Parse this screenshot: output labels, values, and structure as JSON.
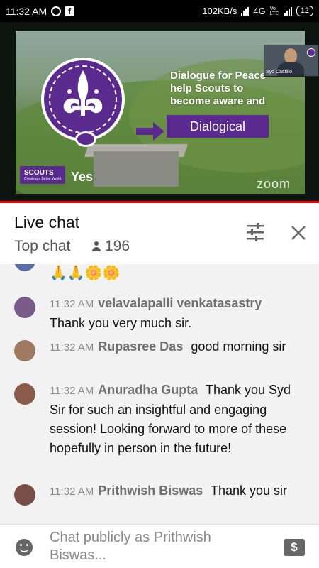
{
  "status_bar": {
    "time": "11:32 AM",
    "speed": "102KB/s",
    "network": "4G",
    "volte": "Vo LTE",
    "battery": "12"
  },
  "video": {
    "slide_text": "Dialogue for Peace help Scouts to become aware and",
    "dialogical": "Dialogical",
    "yes": "Yes",
    "scouts_logo": "SCOUTS",
    "scouts_tagline": "Creating a Better World",
    "zoom_watermark": "zoom",
    "pip_name": "Syd Castillo"
  },
  "chat_header": {
    "title": "Live chat",
    "mode": "Top chat",
    "viewer_count": "196"
  },
  "messages": [
    {
      "emojis": "🙏🙏🌼🌼"
    },
    {
      "time": "11:32 AM",
      "author": "velavalapalli venkatasastry",
      "text": "Thank you very much sir."
    },
    {
      "time": "11:32 AM",
      "author": "Rupasree Das",
      "text": "good morning sir"
    },
    {
      "time": "11:32 AM",
      "author": "Anuradha Gupta",
      "text": "Thank you Syd Sir for such an insightful and engaging session! Looking forward to more of these hopefully in person in the future!"
    },
    {
      "time": "11:32 AM",
      "author": "Prithwish Biswas",
      "text": "Thank you sir"
    }
  ],
  "input": {
    "placeholder": "Chat publicly as Prithwish Biswas...",
    "superchat_symbol": "$"
  },
  "colors": {
    "accent_red": "#e00000",
    "scout_purple": "#5a2a8f"
  }
}
